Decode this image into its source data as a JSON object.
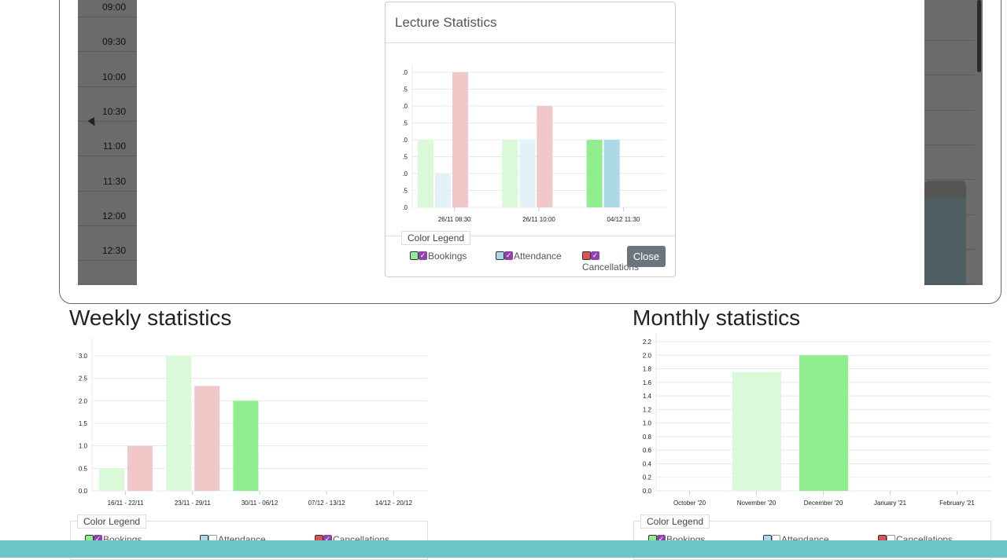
{
  "calendar": {
    "times": [
      "09:00",
      "09:30",
      "10:00",
      "10:30",
      "11:00",
      "11:30",
      "12:00",
      "12:30"
    ]
  },
  "modal": {
    "title": "Lecture Statistics",
    "legend_title": "Color Legend",
    "legend_items": [
      "Bookings",
      "Attendance",
      "Cancellations"
    ],
    "close_label": "Close"
  },
  "weekly": {
    "title": "Weekly statistics",
    "legend_title": "Color Legend",
    "legend_items": [
      "Bookings",
      "Attendance",
      "Cancellations"
    ]
  },
  "monthly": {
    "title": "Monthly statistics",
    "legend_title": "Color Legend",
    "legend_items": [
      "Bookings",
      "Attendance",
      "Cancellations"
    ]
  },
  "colors": {
    "bookings": "#90ee90",
    "bookings_light": "#d9f9d9",
    "attendance": "#add8e6",
    "attendance_light": "#e3f2f7",
    "cancellations_light": "#f0c8c8",
    "accent_bar": "#6cc5c9"
  },
  "chart_data": [
    {
      "type": "bar",
      "categories": [
        "26/11 08:30",
        "26/11 10:00",
        "04/12 11:30"
      ],
      "yticks": [
        ".0",
        ".5",
        ".0",
        ".5",
        ".0",
        ".5",
        ".0",
        ".5",
        ".0"
      ],
      "series": [
        {
          "name": "Bookings",
          "values": [
            1,
            1,
            1
          ]
        },
        {
          "name": "Attendance",
          "values": [
            0.5,
            1,
            1
          ]
        },
        {
          "name": "Cancellations",
          "values": [
            2,
            1.5,
            0
          ]
        }
      ],
      "ylim": [
        0,
        2
      ]
    },
    {
      "type": "bar",
      "categories": [
        "16/11 - 22/11",
        "23/11 - 29/11",
        "30/11 - 06/12",
        "07/12 - 13/12",
        "14/12 - 20/12"
      ],
      "yticks": [
        "0.0",
        "0.5",
        "1.0",
        "1.5",
        "2.0",
        "2.5",
        "3.0"
      ],
      "series": [
        {
          "name": "Bookings",
          "values": [
            0.5,
            3,
            2,
            0,
            0
          ]
        },
        {
          "name": "Cancellations",
          "values": [
            1,
            2.33,
            0,
            0,
            0
          ]
        }
      ],
      "ylim": [
        0,
        3.3
      ]
    },
    {
      "type": "bar",
      "categories": [
        "October '20",
        "November '20",
        "December '20",
        "January '21",
        "February '21"
      ],
      "yticks": [
        "0.0",
        "0.2",
        "0.4",
        "0.6",
        "0.8",
        "1.0",
        "1.2",
        "1.4",
        "1.6",
        "1.8",
        "2.0",
        "2.2"
      ],
      "series": [
        {
          "name": "Bookings",
          "values": [
            0,
            1.75,
            2,
            0,
            0
          ]
        }
      ],
      "ylim": [
        0,
        2.2
      ]
    }
  ]
}
